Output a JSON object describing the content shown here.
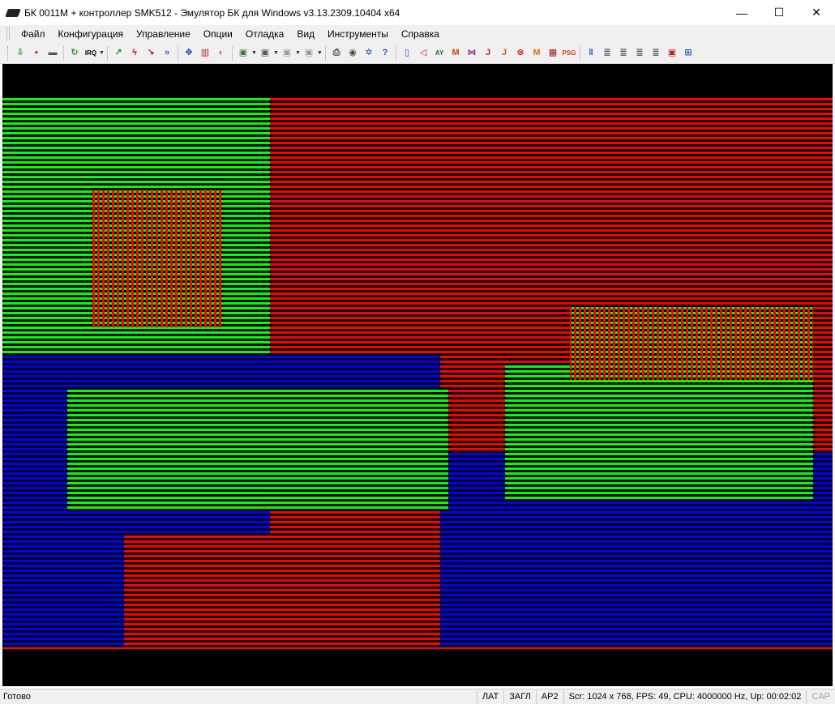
{
  "window": {
    "title": "БК 0011М + контроллер SMK512 - Эмулятор БК для Windows v3.13.2309.10404 x64",
    "minimize": "—",
    "maximize": "☐",
    "close": "✕"
  },
  "menu": {
    "items": [
      "Файл",
      "Конфигурация",
      "Управление",
      "Опции",
      "Отладка",
      "Вид",
      "Инструменты",
      "Справка"
    ]
  },
  "toolbar": {
    "buttons": [
      {
        "name": "load-icon",
        "glyph": "⇩",
        "color": "#1a8a1a"
      },
      {
        "name": "save-icon",
        "glyph": "▪",
        "color": "#b01010"
      },
      {
        "name": "drive-icon",
        "glyph": "▬",
        "color": "#555555"
      },
      {
        "name": "reset-icon",
        "glyph": "↻",
        "color": "#1a9a1a"
      },
      {
        "name": "irq-icon",
        "glyph": "IRQ",
        "color": "#000000"
      },
      {
        "name": "run-icon",
        "glyph": "↗",
        "color": "#1a8a1a"
      },
      {
        "name": "stop-icon",
        "glyph": "ϟ",
        "color": "#d01010"
      },
      {
        "name": "step-icon",
        "glyph": "↘",
        "color": "#c01010"
      },
      {
        "name": "skip-icon",
        "glyph": "»",
        "color": "#2060d0"
      },
      {
        "name": "fullscreen-icon",
        "glyph": "✥",
        "color": "#1040c0"
      },
      {
        "name": "palette-icon",
        "glyph": "▥",
        "color": "#c02020"
      },
      {
        "name": "colormode-icon",
        "glyph": "◐",
        "color": "#808080"
      },
      {
        "name": "screenshot-icon",
        "glyph": "▣",
        "color": "#3a7a3a"
      },
      {
        "name": "video-icon",
        "glyph": "▣",
        "color": "#555555"
      },
      {
        "name": "monitor-icon",
        "glyph": "▣",
        "color": "#999999"
      },
      {
        "name": "display-icon",
        "glyph": "▣",
        "color": "#999999"
      },
      {
        "name": "print-icon",
        "glyph": "⎙",
        "color": "#444444"
      },
      {
        "name": "record-icon",
        "glyph": "◉",
        "color": "#444444"
      },
      {
        "name": "settings-icon",
        "glyph": "✲",
        "color": "#2050b0"
      },
      {
        "name": "help-icon",
        "glyph": "?",
        "color": "#2050b0"
      },
      {
        "name": "speaker-icon",
        "glyph": "▯",
        "color": "#2050c0"
      },
      {
        "name": "sound-icon",
        "glyph": "◁",
        "color": "#c02080"
      },
      {
        "name": "ay-icon",
        "glyph": "AY",
        "color": "#207020"
      },
      {
        "name": "mute-icon",
        "glyph": "M",
        "color": "#d04010"
      },
      {
        "name": "covox-icon",
        "glyph": "⋈",
        "color": "#a02080"
      },
      {
        "name": "joystick-icon",
        "glyph": "J",
        "color": "#c02020"
      },
      {
        "name": "joystick2-icon",
        "glyph": "J",
        "color": "#c06010"
      },
      {
        "name": "tape-icon",
        "glyph": "⊛",
        "color": "#c02020"
      },
      {
        "name": "menestrel-icon",
        "glyph": "M",
        "color": "#e07010"
      },
      {
        "name": "memory-icon",
        "glyph": "▦",
        "color": "#b01010"
      },
      {
        "name": "psg-icon",
        "glyph": "PSG",
        "color": "#d04010"
      },
      {
        "name": "pause-icon",
        "glyph": "‖",
        "color": "#2050c0"
      },
      {
        "name": "debug-icon",
        "glyph": "≣",
        "color": "#555555"
      },
      {
        "name": "debug2-icon",
        "glyph": "≣",
        "color": "#555555"
      },
      {
        "name": "debug3-icon",
        "glyph": "≣",
        "color": "#555555"
      },
      {
        "name": "debug4-icon",
        "glyph": "≣",
        "color": "#555555"
      },
      {
        "name": "window-icon",
        "glyph": "▣",
        "color": "#c02020"
      },
      {
        "name": "layout-icon",
        "glyph": "⊞",
        "color": "#2050c0"
      }
    ]
  },
  "screen": {
    "colors": {
      "black": "#000000",
      "red": "#ff0000",
      "green": "#00ff00",
      "blue": "#0000ff"
    }
  },
  "status": {
    "ready": "Готово",
    "lat": "ЛАТ",
    "zagl": "ЗАГЛ",
    "ar2": "АР2",
    "info": "Scr: 1024 x 768, FPS: 49, CPU: 4000000 Hz, Up: 00:02:02",
    "cap": "CAP"
  }
}
